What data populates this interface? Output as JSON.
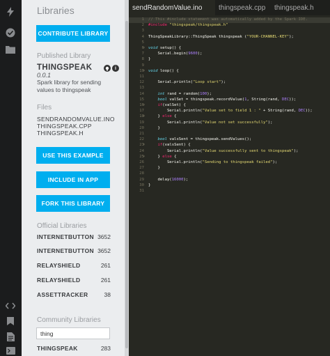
{
  "rail": {
    "icons": [
      "flash-icon",
      "check-circle-icon",
      "folder-icon",
      "code-icon",
      "bookmark-icon",
      "file-icon",
      "console-icon"
    ]
  },
  "panel": {
    "title": "Libraries",
    "contribute_label": "CONTRIBUTE LIBRARY",
    "published_heading": "Published Library",
    "library": {
      "name": "THINGSPEAK",
      "version": "0.0.1",
      "description": "Spark library for sending values to thingspeak"
    },
    "files_heading": "Files",
    "files": [
      "SENDRANDOMVALUE.INO",
      "THINGSPEAK.CPP",
      "THINGSPEAK.H"
    ],
    "use_example_label": "USE THIS EXAMPLE",
    "include_app_label": "INCLUDE IN APP",
    "fork_label": "FORK THIS LIBRARY",
    "official_heading": "Official Libraries",
    "official": [
      {
        "name": "INTERNETBUTTON",
        "count": "3652"
      },
      {
        "name": "INTERNETBUTTON",
        "count": "3652"
      },
      {
        "name": "RELAYSHIELD",
        "count": "261"
      },
      {
        "name": "RELAYSHIELD",
        "count": "261"
      },
      {
        "name": "ASSETTRACKER",
        "count": "38"
      }
    ],
    "community_heading": "Community Libraries",
    "search_value": "thing",
    "community": [
      {
        "name": "THINGSPEAK",
        "count": "283"
      }
    ]
  },
  "editor": {
    "tabs": [
      "sendRandomValue.ino",
      "thingspeak.cpp",
      "thingspeak.h"
    ],
    "active_tab": 0,
    "line_numbers": [
      "1",
      "2",
      "3",
      "4",
      "5",
      "6",
      "7",
      "8",
      "9",
      "10",
      "11",
      "12",
      "13",
      "14",
      "15",
      "16",
      "17",
      "18",
      "19",
      "20",
      "21",
      "22",
      "23",
      "24",
      "25",
      "26",
      "27",
      "28",
      "29",
      "30",
      "31"
    ],
    "lines": [
      "// This #include statement was automatically added by the Spark IDE.",
      "#include \"thingspeak/thingspeak.h\"",
      "",
      "ThingSpeakLibrary::ThingSpeak thingspeak (\"YOUR-CHANNEL-KEY\");",
      "",
      "void setup() {",
      "    Serial.begin(9600);",
      "}",
      "",
      "void loop() {",
      "",
      "    Serial.println(\"Loop start\");",
      "",
      "    int rand = random(100);",
      "    bool valSet = thingspeak.recordValue(1, String(rand, DEC));",
      "    if(valSet) {",
      "        Serial.println(\"Value set to field 1 : \" + String(rand, DEC));",
      "    } else {",
      "        Serial.println(\"Value not set successfully\");",
      "    }",
      "",
      "    bool valsSent = thingspeak.sendValues();",
      "    if(valsSent) {",
      "        Serial.println(\"Value successfully sent to thingspeak\");",
      "    } else {",
      "        Serial.println(\"Sending to thingspeak failed\");",
      "    }",
      "",
      "    delay(16000);",
      "}",
      ""
    ]
  }
}
